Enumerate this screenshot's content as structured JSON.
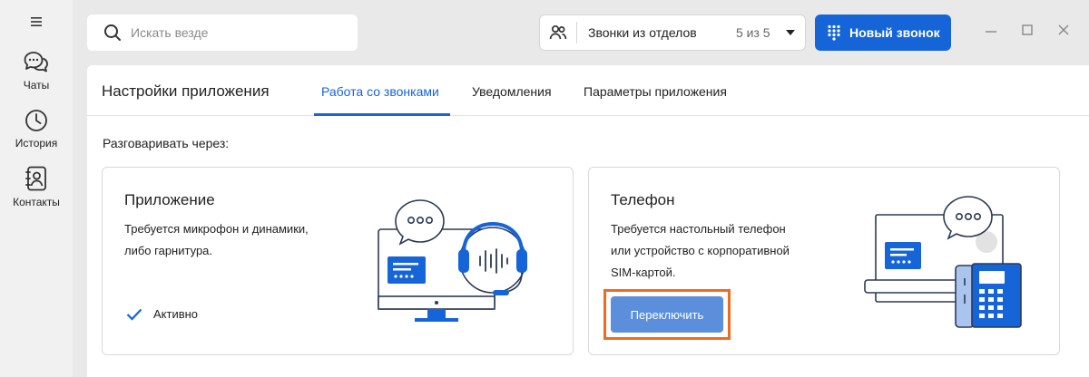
{
  "sidebar": {
    "menu_icon": "hamburger-icon",
    "items": [
      {
        "label": "Чаты",
        "icon": "chats-icon"
      },
      {
        "label": "История",
        "icon": "history-icon"
      },
      {
        "label": "Контакты",
        "icon": "contacts-icon"
      }
    ]
  },
  "search": {
    "placeholder": "Искать везде"
  },
  "department": {
    "label": "Звонки из отделов",
    "count": "5 из 5"
  },
  "new_call": {
    "label": "Новый звонок"
  },
  "panel": {
    "title": "Настройки приложения",
    "tabs": [
      {
        "label": "Работа со звонками",
        "active": true
      },
      {
        "label": "Уведомления",
        "active": false
      },
      {
        "label": "Параметры приложения",
        "active": false
      }
    ],
    "talk_via": "Разговаривать через:"
  },
  "cards": {
    "app": {
      "title": "Приложение",
      "desc_line1": "Требуется микрофон и динамики,",
      "desc_line2": "либо гарнитура.",
      "status": "Активно"
    },
    "phone": {
      "title": "Телефон",
      "desc_line1": "Требуется настольный телефон",
      "desc_line2": "или устройство с корпоративной",
      "desc_line3": "SIM-картой.",
      "button": "Переключить"
    }
  },
  "colors": {
    "accent": "#1565d8",
    "switch_button": "#5b8fdc",
    "highlight": "#f26b1d"
  }
}
